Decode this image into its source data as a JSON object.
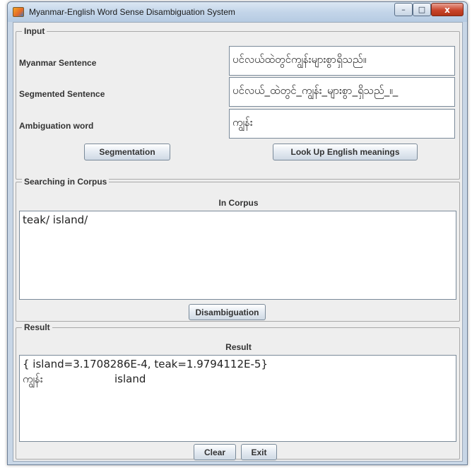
{
  "window": {
    "title": "Myanmar-English Word Sense Disambiguation System",
    "minimize": "–",
    "maximize": "□",
    "close": "x"
  },
  "input": {
    "group_title": "Input",
    "myanmar_label": "Myanmar Sentence",
    "myanmar_value": "ပင်လယ်ထဲတွင်ကျွန်းများစွာရှိသည်။",
    "segmented_label": "Segmented Sentence",
    "segmented_value": "ပင်လယ်_ထဲတွင်_ကျွန်း_များစွာ_ရှိသည်_။_",
    "ambiguation_label": "Ambiguation word",
    "ambiguation_value": "ကျွန်း",
    "segmentation_button": "Segmentation",
    "lookup_button": "Look Up English meanings"
  },
  "corpus": {
    "group_title": "Searching in Corpus",
    "heading": "In Corpus",
    "text": "teak/ island/",
    "disambiguation_button": "Disambiguation"
  },
  "result": {
    "group_title": "Result",
    "heading": "Result",
    "line1": "{ island=3.1708286E-4, teak=1.9794112E-5}",
    "line2_word": "ကျွန်း",
    "line2_meaning": "island",
    "clear_button": "Clear",
    "exit_button": "Exit"
  }
}
